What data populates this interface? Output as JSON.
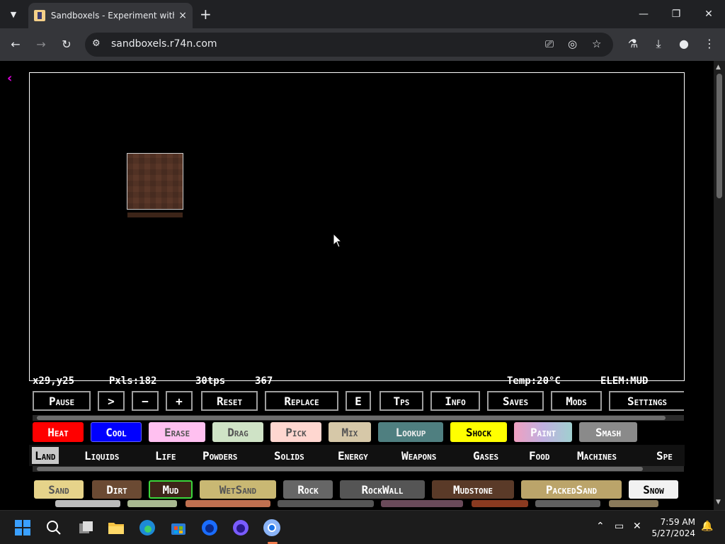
{
  "browser": {
    "tab_title": "Sandboxels - Experiment with Physics",
    "url": "sandboxels.r74n.com",
    "new_tab": "+",
    "close_tab": "×",
    "minimize": "—",
    "maximize": "❐",
    "close_window": "✕"
  },
  "stats": {
    "coords": "x29,y25",
    "pixels": "Pxls:182",
    "tps": "30tps",
    "ticks": "367",
    "temp": "Temp:20°C",
    "elem": "ELEM:MUD"
  },
  "controls": [
    "Pause",
    ">",
    "−",
    "+",
    "Reset",
    "Replace",
    "E",
    "Tps",
    "Info",
    "Saves",
    "Mods",
    "Settings"
  ],
  "tools": [
    {
      "label": "Heat",
      "bg": "#ff0000",
      "fg": "#ffffff"
    },
    {
      "label": "Cool",
      "bg": "#0000ff",
      "fg": "#ffffff"
    },
    {
      "label": "Erase",
      "bg": "#ffc0f0",
      "fg": "#555555"
    },
    {
      "label": "Drag",
      "bg": "#cfe3c6",
      "fg": "#555555"
    },
    {
      "label": "Pick",
      "bg": "#ffd7d0",
      "fg": "#555555"
    },
    {
      "label": "Mix",
      "bg": "#d6c8a8",
      "fg": "#555555"
    },
    {
      "label": "Lookup",
      "bg": "#4f7f80",
      "fg": "#eeeeee"
    },
    {
      "label": "Shock",
      "bg": "#ffff00",
      "fg": "#000000"
    },
    {
      "label": "Paint",
      "bg": "#d8a6c8",
      "fg": "#ffffff"
    },
    {
      "label": "Smash",
      "bg": "#8a8a8a",
      "fg": "#ffffff"
    }
  ],
  "categories": [
    "Land",
    "Liquids",
    "Life",
    "Powders",
    "Solids",
    "Energy",
    "Weapons",
    "Gases",
    "Food",
    "Machines",
    "Spe"
  ],
  "elements": [
    {
      "label": "Sand",
      "bg": "#e6d38a",
      "fg": "#555555"
    },
    {
      "label": "Dirt",
      "bg": "#6b4a33",
      "fg": "#ffffff"
    },
    {
      "label": "Mud",
      "bg": "#3d2519",
      "fg": "#ffffff",
      "selected": true
    },
    {
      "label": "WetSand",
      "bg": "#c9b873",
      "fg": "#555555"
    },
    {
      "label": "Rock",
      "bg": "#666666",
      "fg": "#ffffff"
    },
    {
      "label": "RockWall",
      "bg": "#555555",
      "fg": "#ffffff"
    },
    {
      "label": "Mudstone",
      "bg": "#5a3a28",
      "fg": "#ffffff"
    },
    {
      "label": "PackedSand",
      "bg": "#bba46a",
      "fg": "#ffffff"
    },
    {
      "label": "Snow",
      "bg": "#f2f2f2",
      "fg": "#000000"
    }
  ],
  "clock": {
    "time": "7:59 AM",
    "date": "5/27/2024"
  }
}
